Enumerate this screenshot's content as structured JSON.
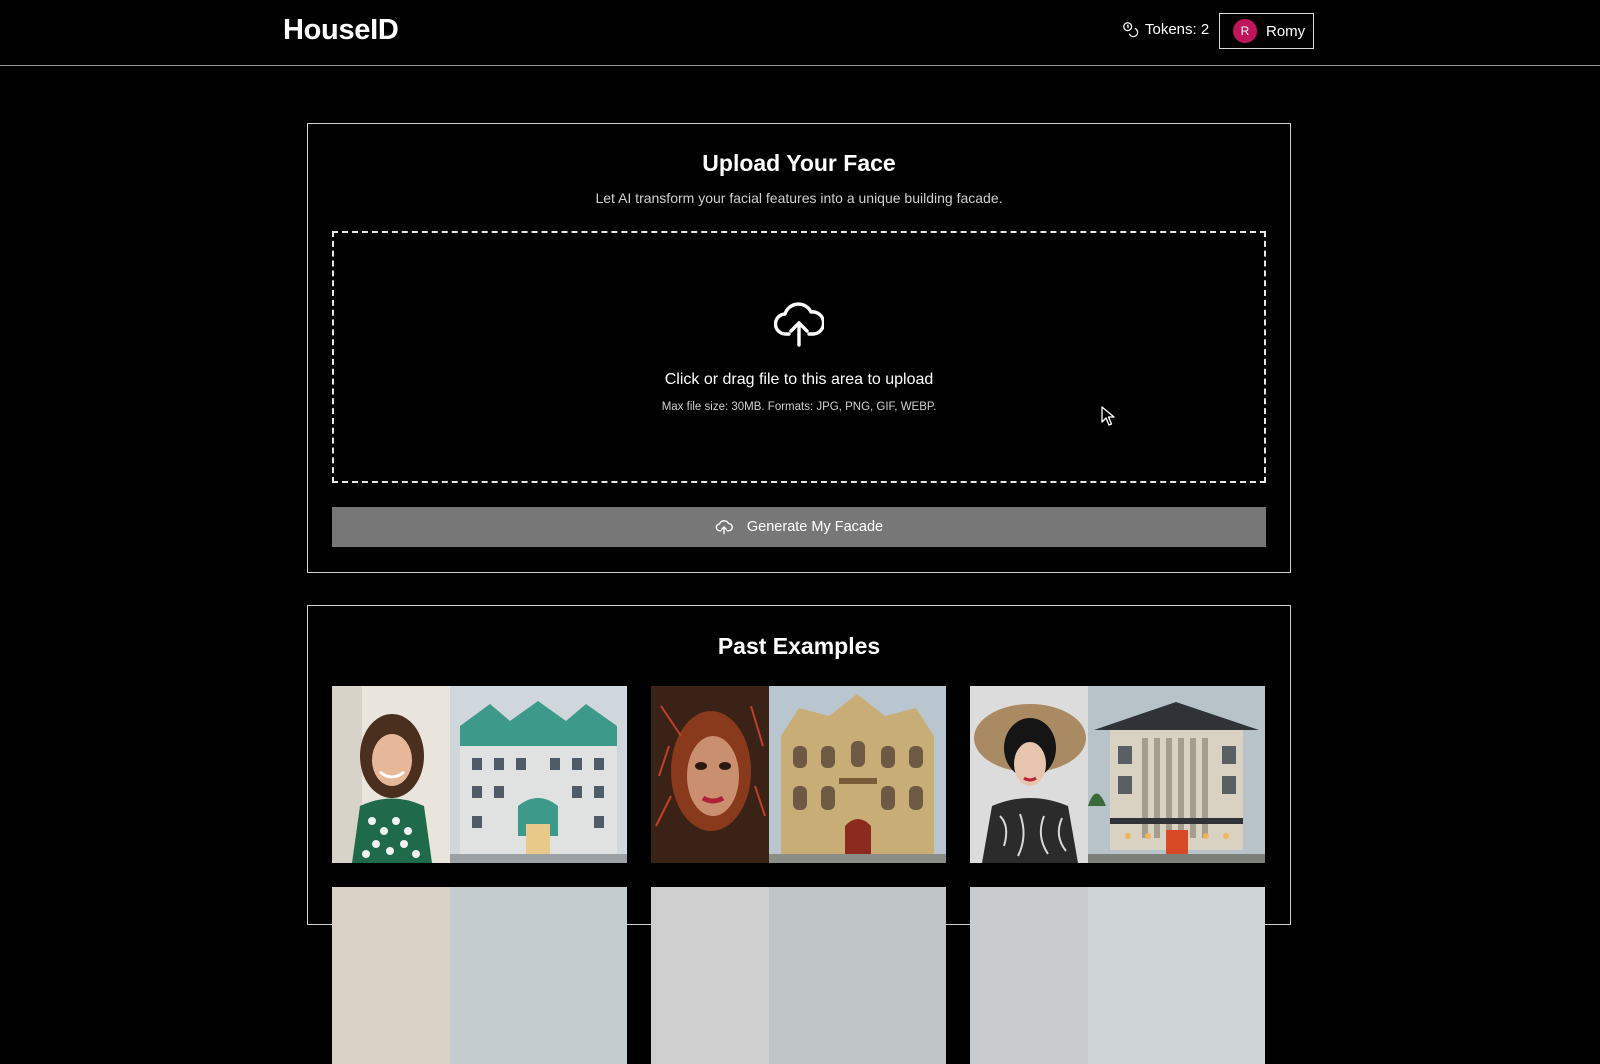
{
  "header": {
    "brand": "HouseID",
    "tokens_label": "Tokens: 2",
    "tokens_icon": "coins-icon",
    "user": {
      "initial": "R",
      "name": "Romy",
      "avatar_color": "#c0155a"
    }
  },
  "upload": {
    "title": "Upload Your Face",
    "subtitle": "Let AI transform your facial features into a unique building facade.",
    "dropzone": {
      "icon": "cloud-upload-icon",
      "main_text": "Click or drag file to this area to upload",
      "hint": "Max file size: 30MB. Formats: JPG, PNG, GIF, WEBP."
    },
    "generate_button": {
      "label": "Generate My Facade",
      "icon": "cloud-upload-icon"
    }
  },
  "examples": {
    "title": "Past Examples",
    "items": [
      {
        "face": "smiling woman with curly hair",
        "facade": "green and white building"
      },
      {
        "face": "woman with red leaves",
        "facade": "ornate beige mansion"
      },
      {
        "face": "woman in straw hat",
        "facade": "modern pagoda-style building"
      }
    ]
  },
  "colors": {
    "background": "#000000",
    "border": "#cfcfcf",
    "button_bg": "#777777",
    "avatar": "#c0155a"
  }
}
